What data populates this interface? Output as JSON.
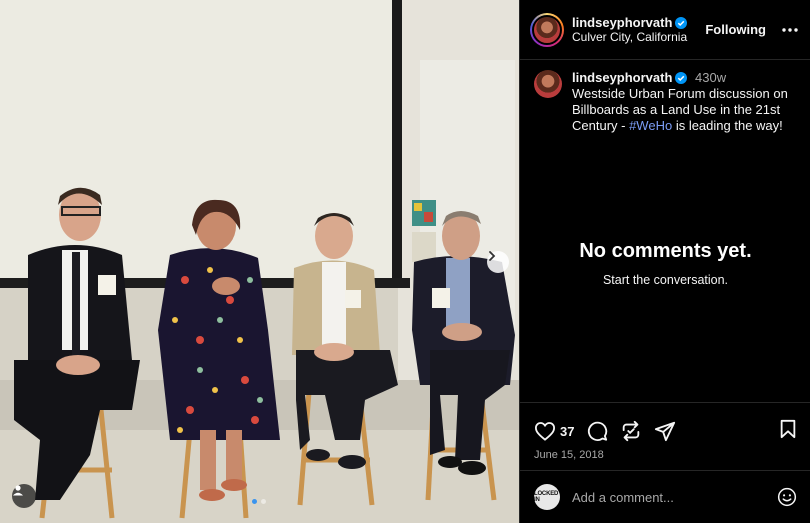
{
  "post": {
    "username": "lindseyphorvath",
    "location": "Culver City, California",
    "follow_state": "Following",
    "age": "430w",
    "caption_text_1": "Westside Urban Forum discussion on Billboards as a Land Use in the 21st Century - ",
    "hashtag": "#WeHo",
    "caption_text_2": " is leading the way!",
    "likes": "37",
    "date": "June 15, 2018",
    "carousel": {
      "count": 2,
      "active": 1
    }
  },
  "comments": {
    "empty_title": "No comments yet.",
    "empty_subtitle": "Start the conversation."
  },
  "composer": {
    "placeholder": "Add a comment...",
    "avatar_text": "LOCKED IN"
  },
  "icons": {
    "verified": "verified-badge-icon",
    "more": "more-options-icon",
    "like": "heart-icon",
    "comment": "comment-icon",
    "repost": "repost-icon",
    "share": "share-icon",
    "save": "bookmark-icon",
    "emoji": "emoji-icon",
    "next": "chevron-right-icon",
    "tag": "user-tag-icon"
  },
  "colors": {
    "verified": "#0095f6",
    "hashtag": "#7b9cf5",
    "active_dot": "#3a94ee"
  }
}
